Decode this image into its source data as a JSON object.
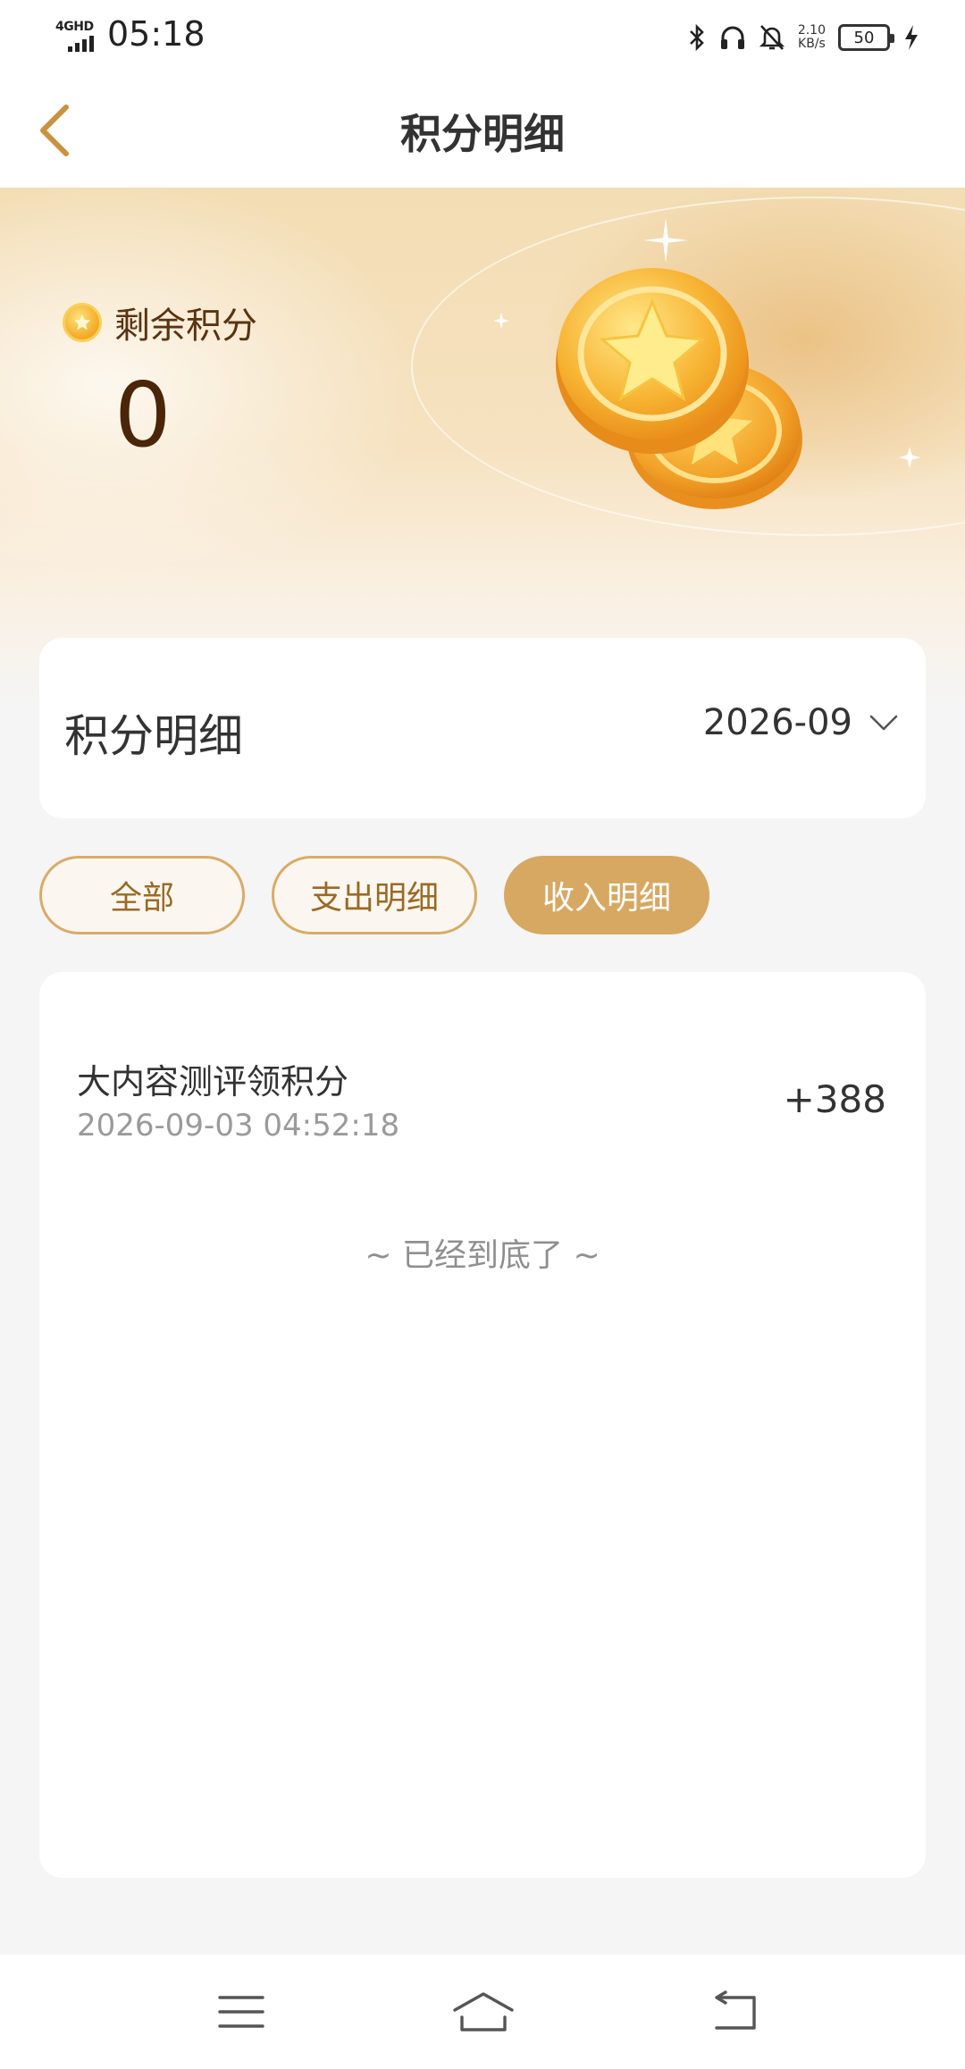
{
  "status_bar": {
    "network": "4GHD",
    "time": "05:18",
    "speed_value": "2.10",
    "speed_unit": "KB/s",
    "battery": "50",
    "icons": [
      "bluetooth-icon",
      "headphones-icon",
      "mute-bell-icon",
      "charging-icon"
    ]
  },
  "header": {
    "title": "积分明细",
    "back_icon": "chevron-left-icon"
  },
  "banner": {
    "label": "剩余积分",
    "points": "0"
  },
  "detail_card": {
    "title": "积分明细",
    "month": "2026-09"
  },
  "tabs": [
    {
      "label": "全部",
      "active": false
    },
    {
      "label": "支出明细",
      "active": false
    },
    {
      "label": "收入明细",
      "active": true
    }
  ],
  "records": [
    {
      "title": "大内容测评领积分",
      "time": "2026-09-03 04:52:18",
      "amount": "+388"
    }
  ],
  "end_text": "~ 已经到底了 ~",
  "colors": {
    "accent": "#d7a862",
    "accent_text": "#9a6a25",
    "points_text": "#4a2507",
    "background": "#f5f5f5"
  },
  "navbar": {
    "icons": [
      "menu-icon",
      "home-icon",
      "back-icon"
    ]
  }
}
